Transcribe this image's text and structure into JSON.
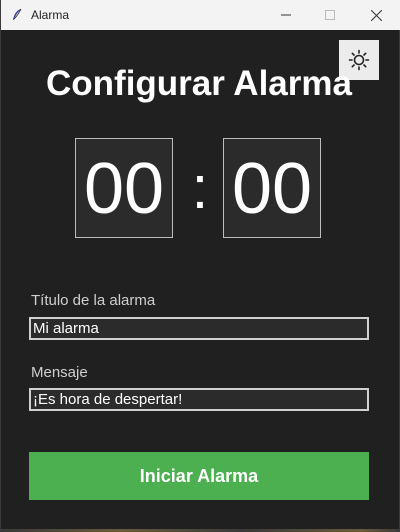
{
  "window": {
    "title": "Alarma",
    "icon": "feather-icon",
    "controls": [
      "minimize-icon",
      "maximize-icon",
      "close-icon"
    ]
  },
  "theme_toggle": {
    "icon": "sun-icon"
  },
  "header": {
    "title": "Configurar Alarma"
  },
  "time": {
    "hours": "00",
    "separator": ":",
    "minutes": "00"
  },
  "form": {
    "title_label": "Título de la alarma",
    "title_value": "Mi alarma",
    "message_label": "Mensaje",
    "message_value": "¡Es hora de despertar!"
  },
  "actions": {
    "start_label": "Iniciar Alarma"
  },
  "colors": {
    "background": "#202020",
    "accent": "#4caf50",
    "text": "#ffffff"
  }
}
